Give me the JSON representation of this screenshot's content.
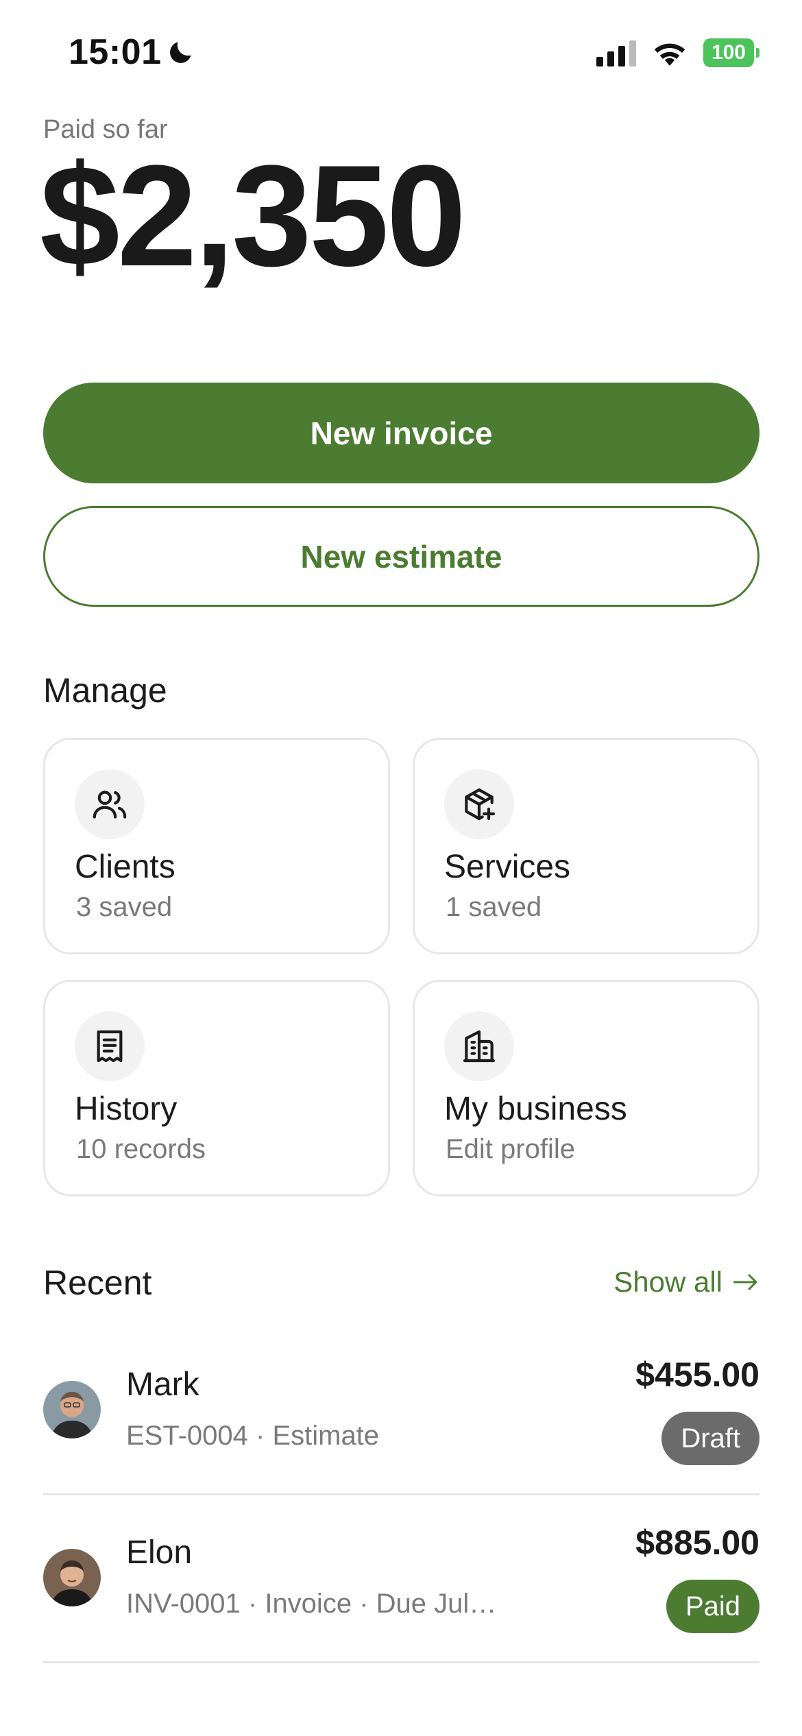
{
  "status_bar": {
    "time": "15:01",
    "battery": "100",
    "icons": [
      "moon-icon",
      "signal-icon",
      "wifi-icon",
      "battery-icon"
    ]
  },
  "summary": {
    "label": "Paid so far",
    "amount": "$2,350"
  },
  "actions": {
    "primary_label": "New invoice",
    "secondary_label": "New estimate"
  },
  "manage": {
    "title": "Manage",
    "cards": [
      {
        "title": "Clients",
        "subtitle": "3 saved",
        "icon": "users-icon"
      },
      {
        "title": "Services",
        "subtitle": "1 saved",
        "icon": "package-plus-icon"
      },
      {
        "title": "History",
        "subtitle": "10 records",
        "icon": "receipt-icon"
      },
      {
        "title": "My business",
        "subtitle": "Edit profile",
        "icon": "building-icon"
      }
    ]
  },
  "recent": {
    "title": "Recent",
    "show_all": "Show all",
    "items": [
      {
        "name": "Mark",
        "meta": "EST-0004 · Estimate",
        "amount": "$455.00",
        "status": "Draft"
      },
      {
        "name": "Elon",
        "meta": "INV-0001 · Invoice · Due Jul…",
        "amount": "$885.00",
        "status": "Paid"
      }
    ]
  },
  "colors": {
    "accent": "#4b7c31",
    "draft_badge": "#6b6b6b",
    "battery": "#4cc35b"
  }
}
